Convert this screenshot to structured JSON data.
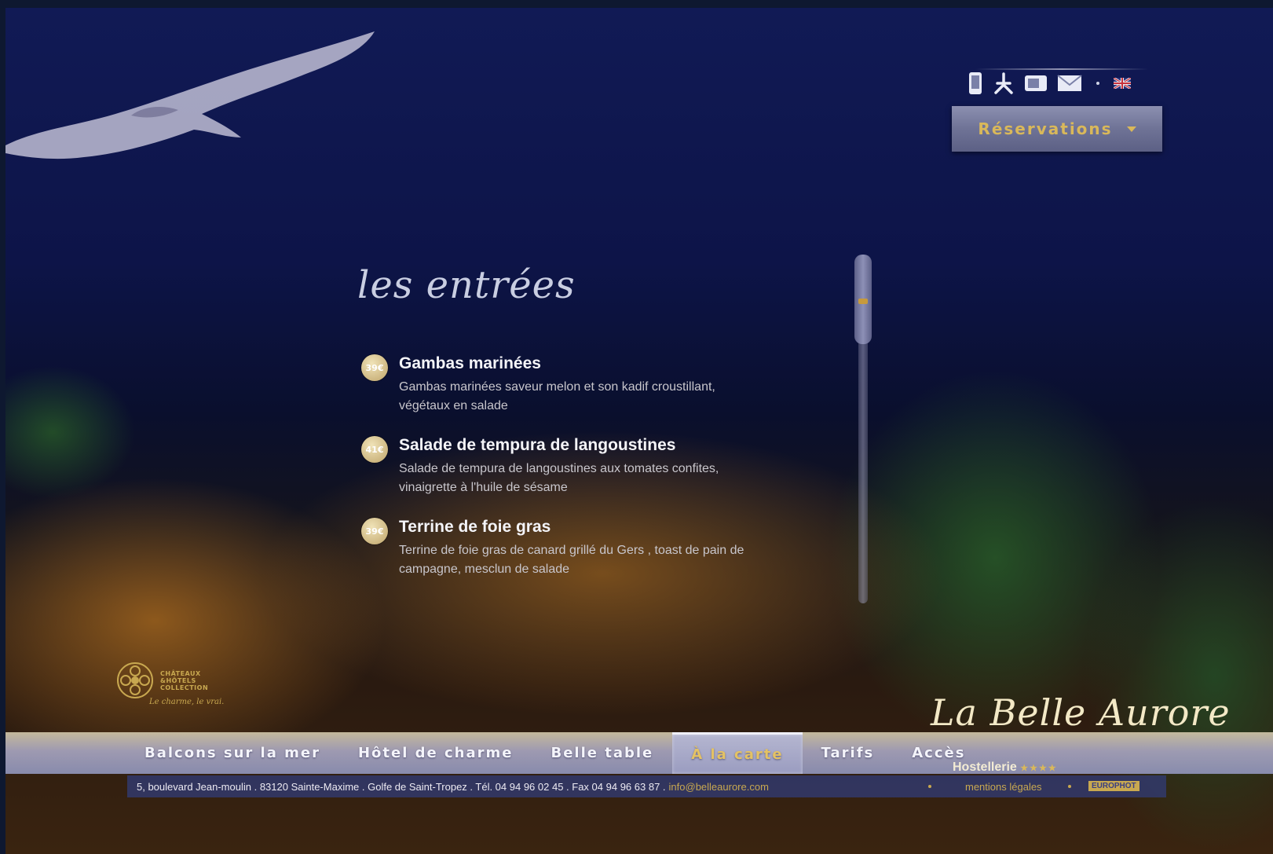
{
  "toolbar": {
    "icons": [
      "mobile-icon",
      "pdf-icon",
      "gallery-icon",
      "mail-icon",
      "flag-uk-icon"
    ],
    "reservations_label": "Réservations"
  },
  "section": {
    "title": "les entrées"
  },
  "menu_items": [
    {
      "price": "39€",
      "name": "Gambas marinées",
      "description": "Gambas marinées saveur melon et son kadif croustillant, végétaux en salade"
    },
    {
      "price": "41€",
      "name": "Salade de tempura de langoustines",
      "description": "Salade de tempura de langoustines aux tomates confites, vinaigrette à l'huile de sésame"
    },
    {
      "price": "39€",
      "name": "Terrine de foie gras",
      "description": "Terrine de foie gras de canard grillé du Gers , toast de pain de campagne, mesclun de salade"
    }
  ],
  "badge": {
    "lines": [
      "CHÂTEAUX",
      "&HÔTELS",
      "COLLECTION"
    ],
    "tagline": "Le charme, le vrai."
  },
  "nav": {
    "items": [
      "Balcons sur la mer",
      "Hôtel de charme",
      "Belle table",
      "À la carte",
      "Tarifs",
      "Accès"
    ],
    "active_index": 3
  },
  "brand": {
    "name": "La Belle Aurore",
    "subtitle": "Hostellerie",
    "stars": "★★★★"
  },
  "footer": {
    "address": "5, boulevard Jean-moulin . 83120 Sainte-Maxime . Golfe de Saint-Tropez . Tél. 04 94 96 02 45 . Fax 04 94 96 63 87 .",
    "email": "info@belleaurore.com",
    "legal": "mentions légales",
    "credit": "EUROPHOT"
  },
  "colors": {
    "accent_gold": "#d9b85a",
    "nav_text": "#f4f4fa",
    "background_navy": "#0d1448"
  }
}
